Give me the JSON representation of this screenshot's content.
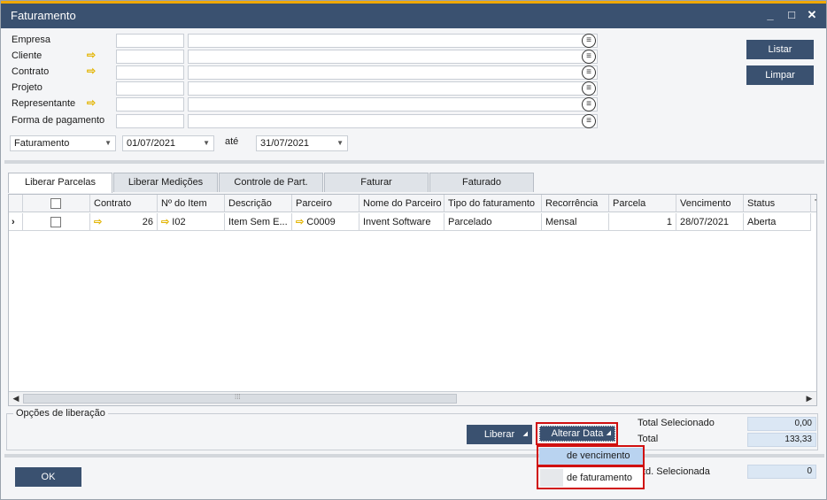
{
  "window": {
    "title": "Faturamento",
    "controls": [
      "_",
      "□",
      "✕"
    ]
  },
  "form": {
    "fields": [
      {
        "label": "Empresa",
        "has_link_arrow": false
      },
      {
        "label": "Cliente",
        "has_link_arrow": true
      },
      {
        "label": "Contrato",
        "has_link_arrow": true
      },
      {
        "label": "Projeto",
        "has_link_arrow": false
      },
      {
        "label": "Representante",
        "has_link_arrow": true
      },
      {
        "label": "Forma de pagamento",
        "has_link_arrow": false
      }
    ],
    "date_type": "Faturamento",
    "date_from": "01/07/2021",
    "date_sep": "até",
    "date_to": "31/07/2021",
    "list_button": "Listar",
    "clear_button": "Limpar"
  },
  "tabs": [
    {
      "label": "Liberar Parcelas",
      "active": true
    },
    {
      "label": "Liberar Medições",
      "active": false
    },
    {
      "label": "Controle de Part.",
      "active": false
    },
    {
      "label": "Faturar",
      "active": false
    },
    {
      "label": "Faturado",
      "active": false
    }
  ],
  "grid": {
    "columns": [
      "",
      "Contrato",
      "Nº do Item",
      "Descrição",
      "Parceiro",
      "Nome do Parceiro",
      "Tipo do faturamento",
      "Recorrência",
      "Parcela",
      "Vencimento",
      "Status",
      "T"
    ],
    "rows": [
      {
        "row_marker": "›",
        "checked": false,
        "contrato": "26",
        "item": "I02",
        "descricao": "Item Sem E...",
        "parceiro": "C0009",
        "nome_parceiro": "Invent Software",
        "tipo": "Parcelado",
        "recorrencia": "Mensal",
        "parcela": "1",
        "vencimento": "28/07/2021",
        "status": "Aberta"
      }
    ],
    "scrollbar": {
      "left": "◀",
      "right": "▶",
      "grip": "⁞⁞⁞"
    }
  },
  "release_options": {
    "group_title": "Opções de liberação",
    "liberar_button": "Liberar",
    "alterar_data_button": "Alterar Data",
    "menu_items": [
      "de vencimento",
      "de faturamento"
    ],
    "highlight_color": "#d01010"
  },
  "totals": {
    "total_selecionado_label": "Total Selecionado",
    "total_selecionado_value": "0,00",
    "total_label": "Total",
    "total_value": "133,33",
    "qtd_selecionada_label": "td. Selecionada",
    "qtd_selecionada_value": "0"
  },
  "ok_button": "OK",
  "colors": {
    "titlebar": "#3a5170",
    "accent_top": "#f0a800",
    "button": "#3a5170",
    "link_arrow": "#e3b400",
    "value_bg": "#dbe7f4",
    "menu_highlight": "#b9d3f0"
  }
}
